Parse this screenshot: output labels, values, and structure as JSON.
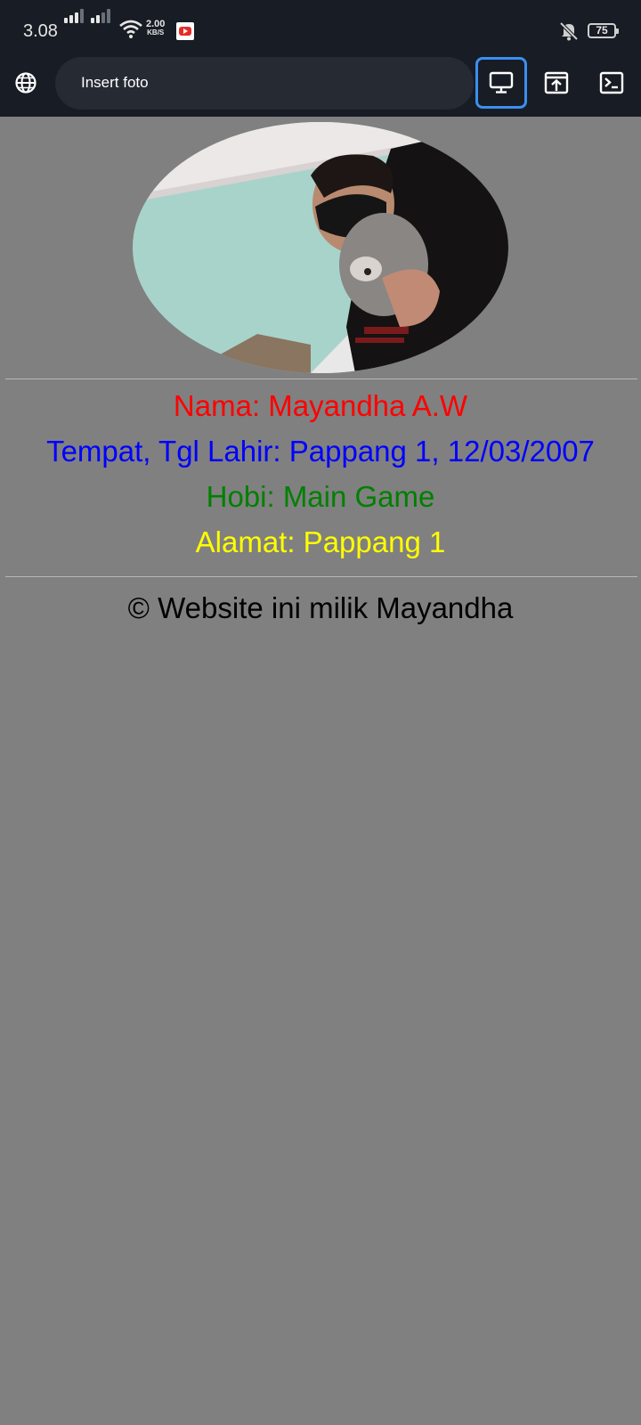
{
  "status_bar": {
    "time": "3.08",
    "speed_value": "2.00",
    "speed_unit": "KB/S",
    "battery": "75",
    "icons": [
      "signal-icon",
      "signal-icon",
      "wifi-icon",
      "youtube-icon",
      "mute-icon",
      "battery-icon"
    ]
  },
  "toolbar": {
    "url_text": "Insert foto",
    "icons": [
      "globe-icon",
      "desktop-icon",
      "open-in-browser-icon",
      "terminal-icon"
    ]
  },
  "profile": {
    "nama": "Nama: Mayandha A.W",
    "ttl": "Tempat, Tgl Lahir: Pappang 1, 12/03/2007",
    "hobi": "Hobi: Main Game",
    "alamat": "Alamat: Pappang 1"
  },
  "footer": {
    "text": "© Website ini milik Mayandha"
  },
  "colors": {
    "page_bg": "#808080",
    "toolbar_bg": "#181c24",
    "nama": "#ff0000",
    "ttl": "#0000ff",
    "hobi": "#008000",
    "alamat": "#ffff00",
    "active_outline": "#3b8ff0"
  }
}
